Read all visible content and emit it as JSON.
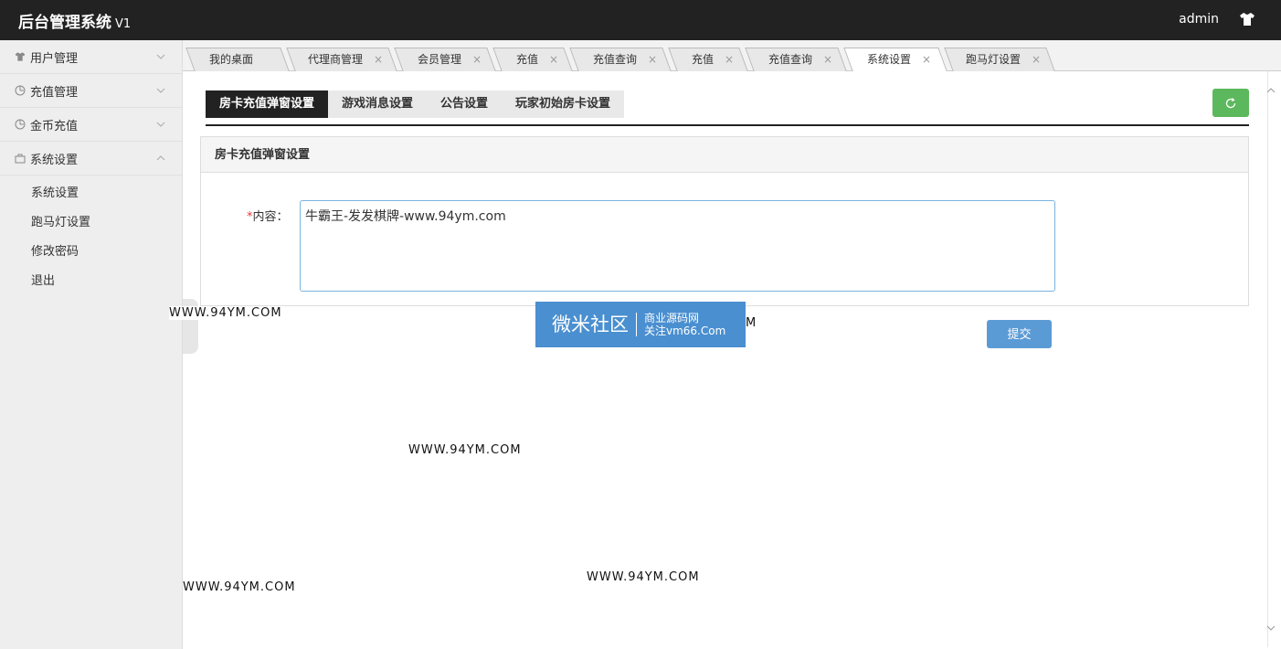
{
  "header": {
    "title": "后台管理系统",
    "version": "V1",
    "user": "admin"
  },
  "sidebar": {
    "items": [
      {
        "label": "用户管理",
        "icon": "shirt-icon"
      },
      {
        "label": "充值管理",
        "icon": "clock-icon"
      },
      {
        "label": "金币充值",
        "icon": "clock-icon"
      },
      {
        "label": "系统设置",
        "icon": "bag-icon"
      }
    ],
    "sub_items": [
      "系统设置",
      "跑马灯设置",
      "修改密码",
      "退出"
    ]
  },
  "tabs": [
    {
      "label": "我的桌面",
      "closable": false
    },
    {
      "label": "代理商管理",
      "closable": true
    },
    {
      "label": "会员管理",
      "closable": true
    },
    {
      "label": "充值",
      "closable": true
    },
    {
      "label": "充值查询",
      "closable": true
    },
    {
      "label": "充值",
      "closable": true
    },
    {
      "label": "充值查询",
      "closable": true
    },
    {
      "label": "系统设置",
      "closable": true,
      "active": true
    },
    {
      "label": "跑马灯设置",
      "closable": true
    }
  ],
  "close_glyph": "×",
  "subtabs": [
    "房卡充值弹窗设置",
    "游戏消息设置",
    "公告设置",
    "玩家初始房卡设置"
  ],
  "panel": {
    "title": "房卡充值弹窗设置",
    "required_mark": "*",
    "label": "内容：",
    "content_value": "牛霸王-发发棋牌-www.94ym.com"
  },
  "submit_label": "提交",
  "watermarks": {
    "text": "WWW.94YM.COM",
    "banner_big": "微米社区",
    "banner_line1": "商业源码网",
    "banner_line2": "关注vm66.Com",
    "cut_text": "M"
  },
  "colors": {
    "header_bg": "#222222",
    "refresh_green": "#5cb85c",
    "submit_blue": "#5b9bd5"
  }
}
